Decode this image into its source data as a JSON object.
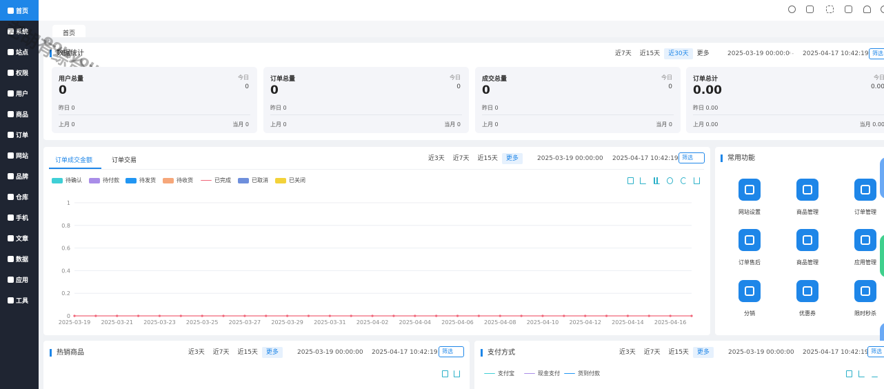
{
  "sidebar": {
    "items": [
      {
        "label": "首页",
        "icon": "home-icon",
        "active": true
      },
      {
        "label": "系统",
        "icon": "gear-icon"
      },
      {
        "label": "站点",
        "icon": "swap-icon"
      },
      {
        "label": "权限",
        "icon": "user-lock-icon"
      },
      {
        "label": "用户",
        "icon": "user-icon"
      },
      {
        "label": "商品",
        "icon": "box-icon"
      },
      {
        "label": "订单",
        "icon": "order-icon"
      },
      {
        "label": "网站",
        "icon": "chat-icon"
      },
      {
        "label": "品牌",
        "icon": "brand-icon"
      },
      {
        "label": "仓库",
        "icon": "warehouse-icon"
      },
      {
        "label": "手机",
        "icon": "phone-icon"
      },
      {
        "label": "文章",
        "icon": "article-icon"
      },
      {
        "label": "数据",
        "icon": "bar-chart-icon"
      },
      {
        "label": "应用",
        "icon": "grid-icon"
      },
      {
        "label": "工具",
        "icon": "wrench-icon"
      }
    ]
  },
  "tabs": {
    "home": "首页"
  },
  "watermark": {
    "line1": "老胡有综合资源网",
    "line2": "oouyouvip.com"
  },
  "stats": {
    "title": "数据统计",
    "ranges": [
      "近7天",
      "近15天",
      "近30天",
      "更多"
    ],
    "active_range": 2,
    "start": "2025-03-19 00:00:00",
    "sep": "-",
    "end": "2025-04-17 10:42:19",
    "filter": "筛选",
    "cards": [
      {
        "title": "用户总量",
        "value": "0",
        "today_label": "今日",
        "today": "0",
        "yesterday": "昨日  0",
        "month": "上月  0",
        "cur_label": "当月",
        "cur": "0"
      },
      {
        "title": "订单总量",
        "value": "0",
        "today_label": "今日",
        "today": "0",
        "yesterday": "昨日 0",
        "month": "上月  0",
        "cur_label": "当月",
        "cur": "0"
      },
      {
        "title": "成交总量",
        "value": "0",
        "today_label": "今日",
        "today": "0",
        "yesterday": "昨日 0",
        "month": "上月  0",
        "cur_label": "当月",
        "cur": "0"
      },
      {
        "title": "订单总计",
        "value": "0.00",
        "today_label": "今日",
        "today": "0.00",
        "yesterday": "昨日 0.00",
        "month": "上月  0.00",
        "cur_label": "当月",
        "cur": "0.00"
      }
    ]
  },
  "order_chart": {
    "tabs": [
      "订单成交金额",
      "订单交易"
    ],
    "ranges": [
      "近3天",
      "近7天",
      "近15天",
      "更多"
    ],
    "start": "2025-03-19 00:00:00",
    "end": "2025-04-17 10:42:19",
    "filter": "筛选",
    "legend": [
      {
        "name": "待确认",
        "color": "#3fcfd6"
      },
      {
        "name": "待付款",
        "color": "#a98de8"
      },
      {
        "name": "待发货",
        "color": "#2196f3"
      },
      {
        "name": "待收货",
        "color": "#f6a77a"
      },
      {
        "name": "已完成",
        "color": "#f06478"
      },
      {
        "name": "已取消",
        "color": "#6e8fdc"
      },
      {
        "name": "已关闭",
        "color": "#f3d23a"
      }
    ]
  },
  "chart_data": {
    "type": "line",
    "x": [
      "2025-03-19",
      "2025-03-20",
      "2025-03-21",
      "2025-03-22",
      "2025-03-23",
      "2025-03-24",
      "2025-03-25",
      "2025-03-26",
      "2025-03-27",
      "2025-03-28",
      "2025-03-29",
      "2025-03-30",
      "2025-03-31",
      "2025-04-01",
      "2025-04-02",
      "2025-04-03",
      "2025-04-04",
      "2025-04-05",
      "2025-04-06",
      "2025-04-07",
      "2025-04-08",
      "2025-04-09",
      "2025-04-10",
      "2025-04-11",
      "2025-04-12",
      "2025-04-13",
      "2025-04-14",
      "2025-04-15",
      "2025-04-16",
      "2025-04-17"
    ],
    "x_ticks": [
      "2025-03-19",
      "2025-03-21",
      "2025-03-23",
      "2025-03-25",
      "2025-03-27",
      "2025-03-29",
      "2025-03-31",
      "2025-04-02",
      "2025-04-04",
      "2025-04-06",
      "2025-04-08",
      "2025-04-10",
      "2025-04-12",
      "2025-04-14",
      "2025-04-16"
    ],
    "y_ticks": [
      "0",
      "0.2",
      "0.4",
      "0.6",
      "0.8",
      "1"
    ],
    "ylim": [
      0,
      1
    ],
    "series": [
      {
        "name": "已完成",
        "values": [
          0,
          0,
          0,
          0,
          0,
          0,
          0,
          0,
          0,
          0,
          0,
          0,
          0,
          0,
          0,
          0,
          0,
          0,
          0,
          0,
          0,
          0,
          0,
          0,
          0,
          0,
          0,
          0,
          0,
          0
        ]
      }
    ]
  },
  "quick": {
    "title": "常用功能",
    "items": [
      {
        "label": "网站设置",
        "icon": "site-settings-icon"
      },
      {
        "label": "商品管理",
        "icon": "goods-bag-icon"
      },
      {
        "label": "订单管理",
        "icon": "order-doc-icon"
      },
      {
        "label": "订单售后",
        "icon": "after-sale-icon"
      },
      {
        "label": "商品管理",
        "icon": "goods-bag-icon"
      },
      {
        "label": "应用管理",
        "icon": "apps-icon"
      },
      {
        "label": "分销",
        "icon": "hierarchy-icon"
      },
      {
        "label": "优惠券",
        "icon": "coupon-icon"
      },
      {
        "label": "限时秒杀",
        "icon": "flash-icon"
      }
    ]
  },
  "hot": {
    "title": "热销商品",
    "ranges": [
      "近3天",
      "近7天",
      "近15天",
      "更多"
    ],
    "start": "2025-03-19 00:00:00",
    "end": "2025-04-17 10:42:19",
    "filter": "筛选"
  },
  "pay": {
    "title": "支付方式",
    "ranges": [
      "近3天",
      "近7天",
      "近15天",
      "更多"
    ],
    "start": "2025-03-19 00:00:00",
    "end": "2025-04-17 10:42:19",
    "filter": "筛选",
    "legend": [
      {
        "name": "支付宝",
        "color": "#3fcfd6"
      },
      {
        "name": "现金支付",
        "color": "#a98de8"
      },
      {
        "name": "货到付款",
        "color": "#2196f3"
      }
    ]
  }
}
